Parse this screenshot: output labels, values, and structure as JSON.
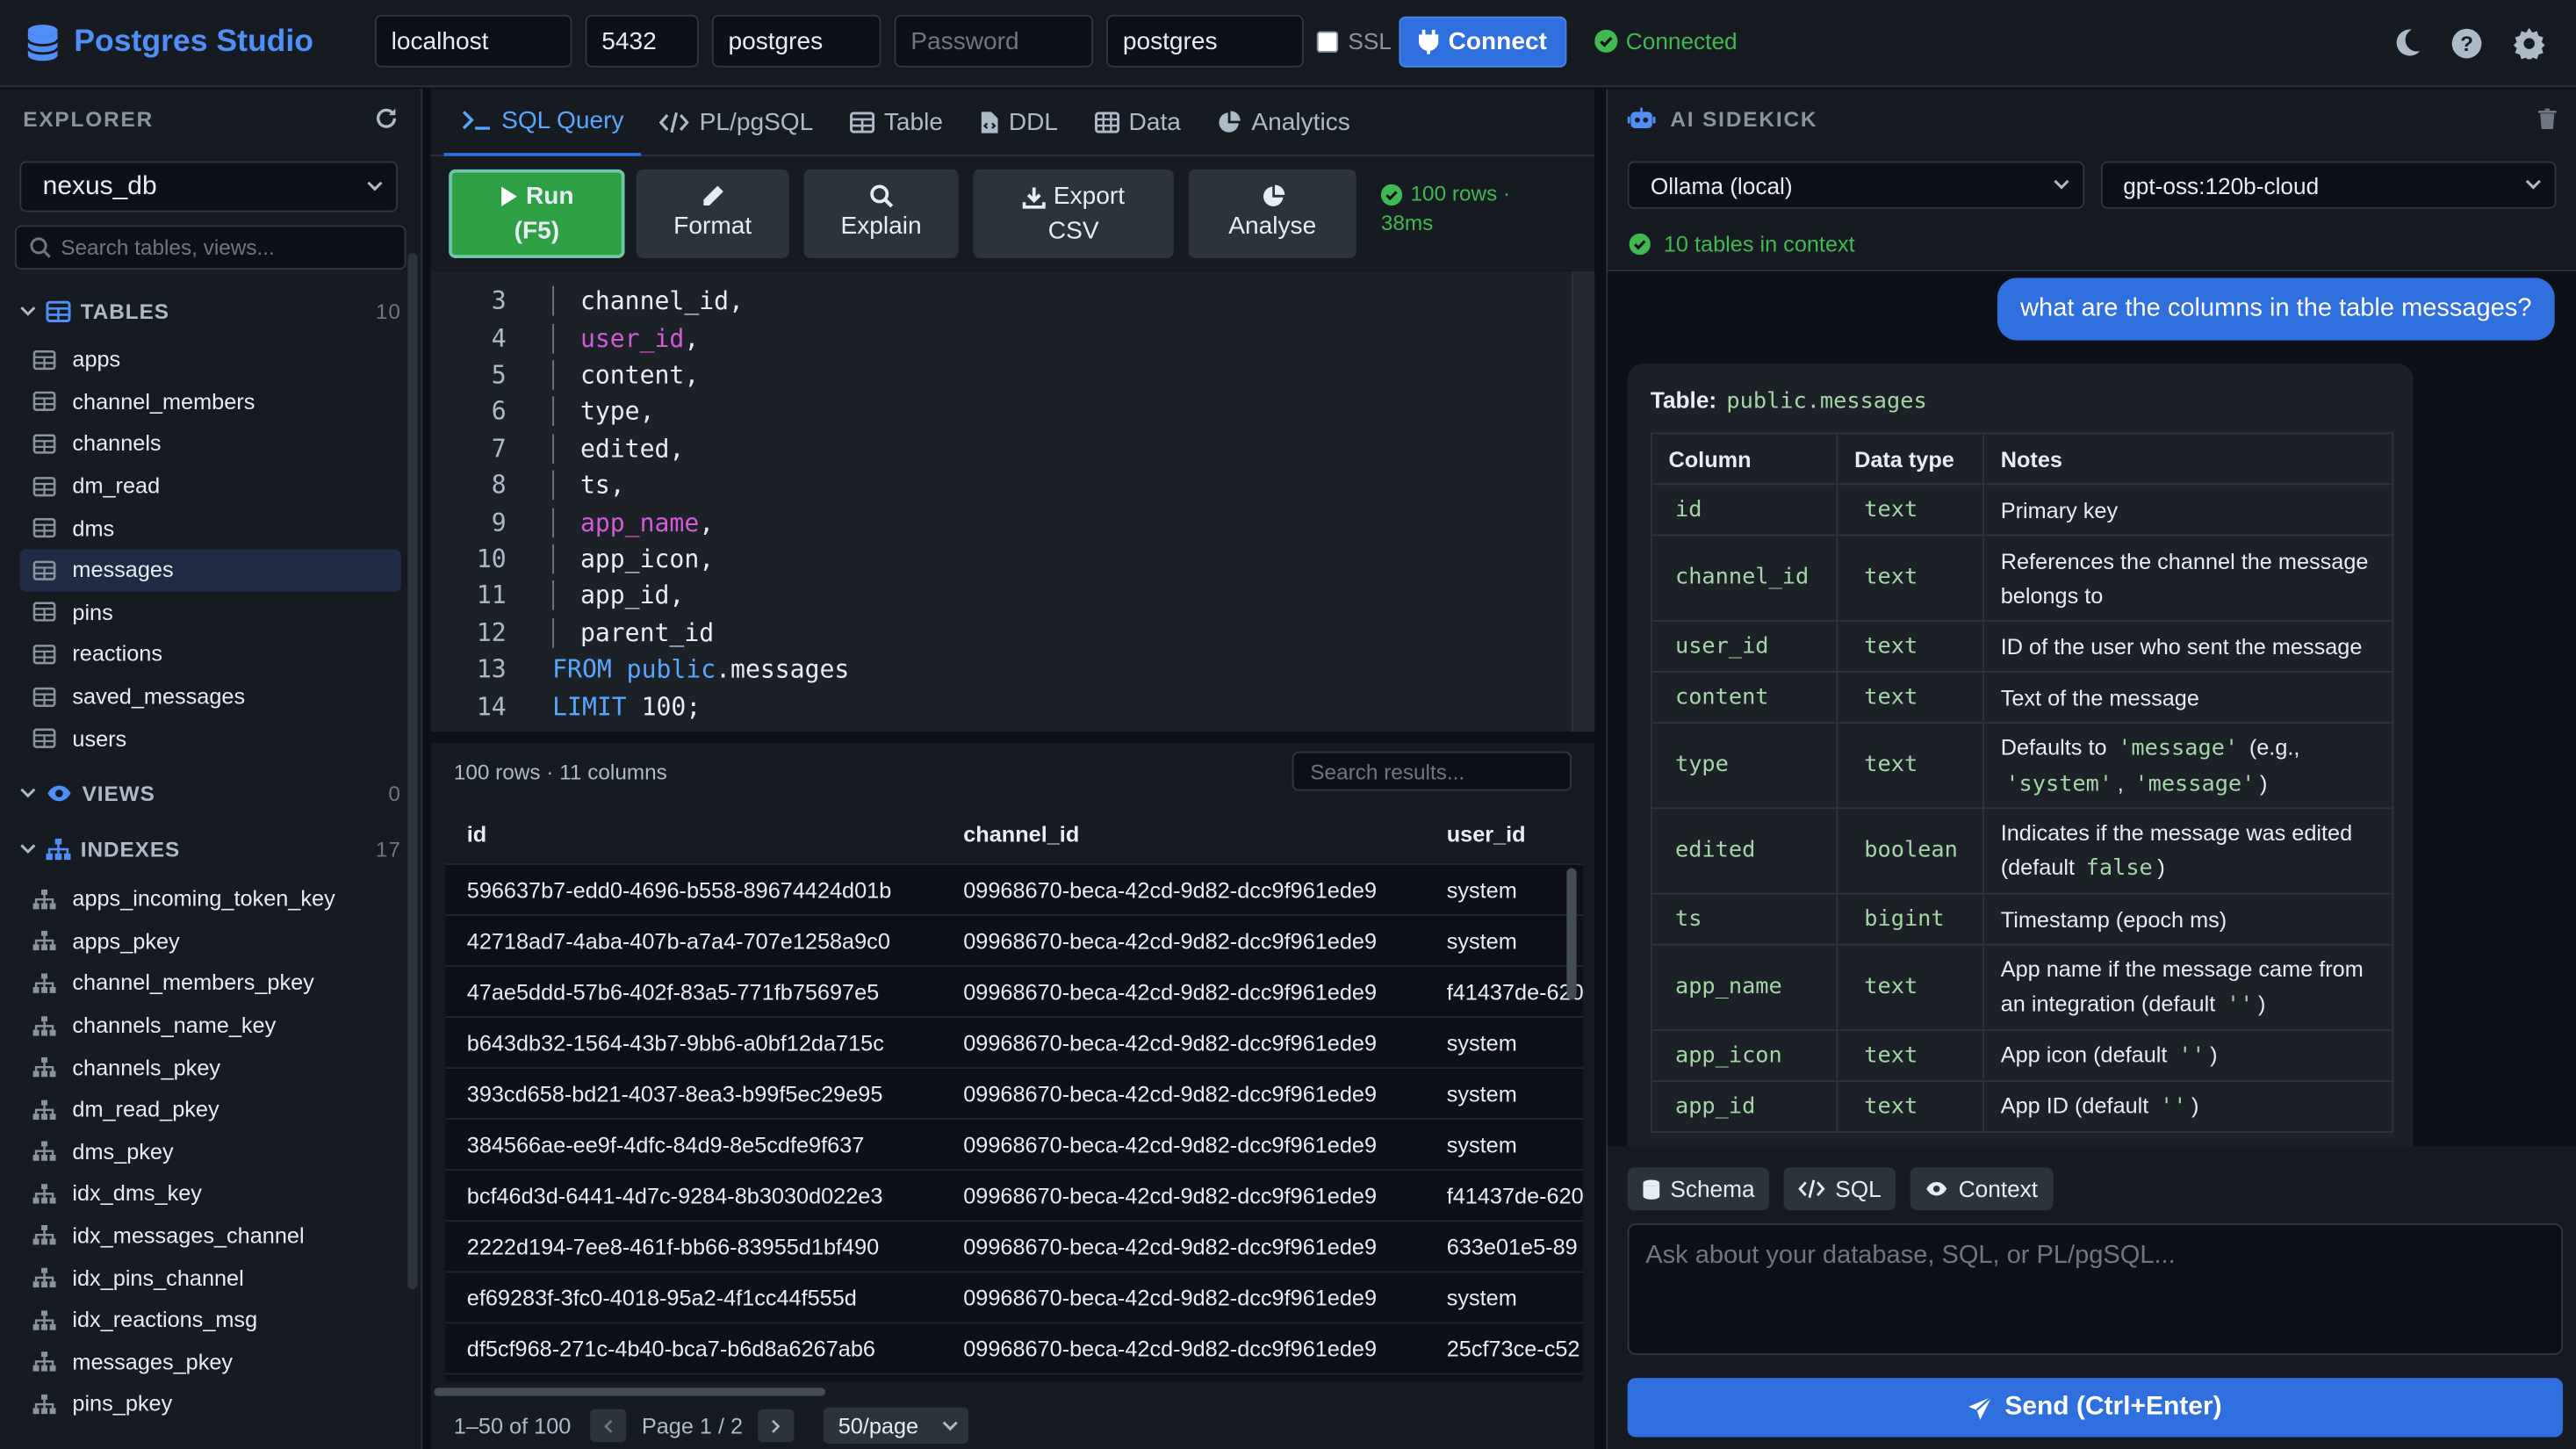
{
  "app": {
    "name": "Postgres Studio",
    "accent": "#2f6fde"
  },
  "connection": {
    "host": "localhost",
    "port": "5432",
    "user": "postgres",
    "password_placeholder": "Password",
    "database": "postgres",
    "ssl_label": "SSL",
    "ssl_checked": false,
    "connect_label": "Connect",
    "status": "Connected"
  },
  "explorer": {
    "title": "EXPLORER",
    "database": "nexus_db",
    "search_placeholder": "Search tables, views...",
    "tables": {
      "label": "TABLES",
      "count": "10",
      "items": [
        "apps",
        "channel_members",
        "channels",
        "dm_read",
        "dms",
        "messages",
        "pins",
        "reactions",
        "saved_messages",
        "users"
      ],
      "active": "messages"
    },
    "views": {
      "label": "VIEWS",
      "count": "0"
    },
    "indexes": {
      "label": "INDEXES",
      "count": "17",
      "items": [
        "apps_incoming_token_key",
        "apps_pkey",
        "channel_members_pkey",
        "channels_name_key",
        "channels_pkey",
        "dm_read_pkey",
        "dms_pkey",
        "idx_dms_key",
        "idx_messages_channel",
        "idx_pins_channel",
        "idx_reactions_msg",
        "messages_pkey",
        "pins_pkey"
      ]
    }
  },
  "tabs": [
    "SQL Query",
    "PL/pgSQL",
    "Table",
    "DDL",
    "Data",
    "Analytics"
  ],
  "toolbar": {
    "run": [
      "Run",
      "(F5)"
    ],
    "format": "Format",
    "explain": "Explain",
    "export": [
      "Export",
      "CSV"
    ],
    "analyse": "Analyse",
    "result_info": [
      "100 rows ·",
      "38ms"
    ]
  },
  "editor": {
    "lines": [
      {
        "n": "3",
        "text": "channel_id,"
      },
      {
        "n": "4",
        "text": "user_id,"
      },
      {
        "n": "5",
        "text": "content,"
      },
      {
        "n": "6",
        "text": "type,"
      },
      {
        "n": "7",
        "text": "edited,"
      },
      {
        "n": "8",
        "text": "ts,"
      },
      {
        "n": "9",
        "text": "app_name,"
      },
      {
        "n": "10",
        "text": "app_icon,"
      },
      {
        "n": "11",
        "text": "app_id,"
      },
      {
        "n": "12",
        "text": "parent_id"
      },
      {
        "n": "13",
        "text": "FROM public.messages"
      },
      {
        "n": "14",
        "text": "LIMIT 100;"
      }
    ]
  },
  "results": {
    "summary": "100 rows · 11 columns",
    "search_placeholder": "Search results...",
    "columns": [
      "id",
      "channel_id",
      "user_id"
    ],
    "rows": [
      [
        "596637b7-edd0-4696-b558-89674424d01b",
        "09968670-beca-42cd-9d82-dcc9f961ede9",
        "system"
      ],
      [
        "42718ad7-4aba-407b-a7a4-707e1258a9c0",
        "09968670-beca-42cd-9d82-dcc9f961ede9",
        "system"
      ],
      [
        "47ae5ddd-57b6-402f-83a5-771fb75697e5",
        "09968670-beca-42cd-9d82-dcc9f961ede9",
        "f41437de-620"
      ],
      [
        "b643db32-1564-43b7-9bb6-a0bf12da715c",
        "09968670-beca-42cd-9d82-dcc9f961ede9",
        "system"
      ],
      [
        "393cd658-bd21-4037-8ea3-b99f5ec29e95",
        "09968670-beca-42cd-9d82-dcc9f961ede9",
        "system"
      ],
      [
        "384566ae-ee9f-4dfc-84d9-8e5cdfe9f637",
        "09968670-beca-42cd-9d82-dcc9f961ede9",
        "system"
      ],
      [
        "bcf46d3d-6441-4d7c-9284-8b3030d022e3",
        "09968670-beca-42cd-9d82-dcc9f961ede9",
        "f41437de-620"
      ],
      [
        "2222d194-7ee8-461f-bb66-83955d1bf490",
        "09968670-beca-42cd-9d82-dcc9f961ede9",
        "633e01e5-89"
      ],
      [
        "ef69283f-3fc0-4018-95a2-4f1cc44f555d",
        "09968670-beca-42cd-9d82-dcc9f961ede9",
        "system"
      ],
      [
        "df5cf968-271c-4b40-bca7-b6d8a6267ab6",
        "09968670-beca-42cd-9d82-dcc9f961ede9",
        "25cf73ce-c52"
      ]
    ],
    "range": "1–50 of 100",
    "page": "Page 1 / 2",
    "per_page": "50/page"
  },
  "ai": {
    "title": "AI SIDEKICK",
    "provider": "Ollama (local)",
    "model": "gpt-oss:120b-cloud",
    "context": "10 tables in context",
    "user_message": "what are the columns in the table messages?",
    "table_label": "Table:",
    "table_name": "public.messages",
    "headers": [
      "Column",
      "Data type",
      "Notes"
    ],
    "rows": [
      {
        "col": "id",
        "type": "text",
        "note": "Primary key"
      },
      {
        "col": "channel_id",
        "type": "text",
        "note": "References the channel the message belongs to"
      },
      {
        "col": "user_id",
        "type": "text",
        "note": "ID of the user who sent the message"
      },
      {
        "col": "content",
        "type": "text",
        "note": "Text of the message"
      },
      {
        "col": "type",
        "type": "text",
        "note": "Defaults to 'message' (e.g., 'system', 'message')"
      },
      {
        "col": "edited",
        "type": "boolean",
        "note": "Indicates if the message was edited (default false)"
      },
      {
        "col": "ts",
        "type": "bigint",
        "note": "Timestamp (epoch ms)"
      },
      {
        "col": "app_name",
        "type": "text",
        "note": "App name if the message came from an integration (default '')"
      },
      {
        "col": "app_icon",
        "type": "text",
        "note": "App icon (default '')"
      },
      {
        "col": "app_id",
        "type": "text",
        "note": "App ID (default '')"
      }
    ],
    "chips": [
      "Schema",
      "SQL",
      "Context"
    ],
    "input_placeholder": "Ask about your database, SQL, or PL/pgSQL...",
    "send_label": "Send (Ctrl+Enter)"
  }
}
